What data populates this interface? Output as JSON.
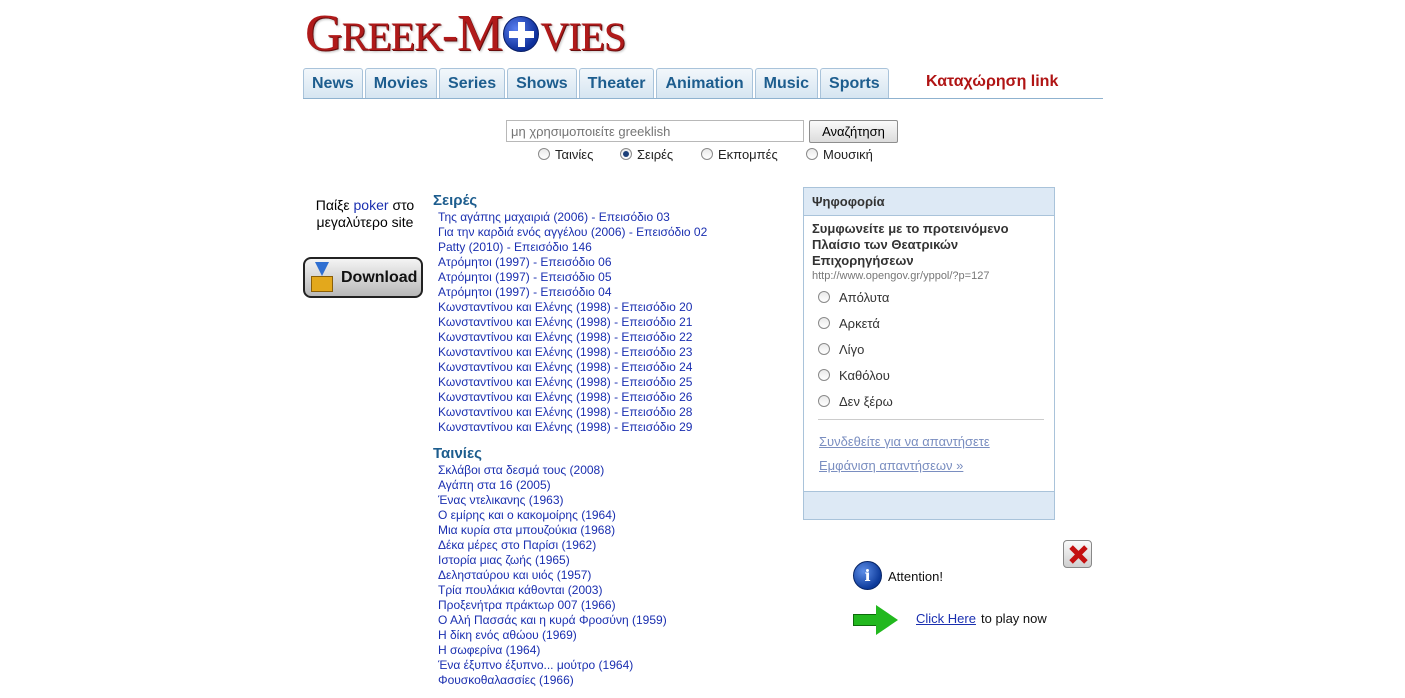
{
  "header": {
    "logo_text": "GREEK-MOVIES",
    "nav": [
      "News",
      "Movies",
      "Series",
      "Shows",
      "Theater",
      "Animation",
      "Music",
      "Sports"
    ],
    "submit_link": "Καταχώρηση link"
  },
  "search": {
    "placeholder": "μη χρησιμοποιείτε greeklish",
    "button_label": "Αναζήτηση",
    "options": [
      "Ταινίες",
      "Σειρές",
      "Εκπομπές",
      "Μουσική"
    ],
    "selected": "Σειρές"
  },
  "left_ad": {
    "text_before": "Παίξε",
    "link": "poker",
    "text_after": "στο μεγαλύτερο site",
    "download_label": "Download"
  },
  "series": {
    "title": "Σειρές",
    "items": [
      "Της αγάπης μαχαιριά (2006) - Επεισόδιο 03",
      "Για την καρδιά ενός αγγέλου (2006) - Επεισόδιο 02",
      "Patty (2010) - Επεισόδιο 146",
      "Ατρόμητοι (1997) - Επεισόδιο 06",
      "Ατρόμητοι (1997) - Επεισόδιο 05",
      "Ατρόμητοι (1997) - Επεισόδιο 04",
      "Κωνσταντίνου και Ελένης (1998) - Επεισόδιο 20",
      "Κωνσταντίνου και Ελένης (1998) - Επεισόδιο 21",
      "Κωνσταντίνου και Ελένης (1998) - Επεισόδιο 22",
      "Κωνσταντίνου και Ελένης (1998) - Επεισόδιο 23",
      "Κωνσταντίνου και Ελένης (1998) - Επεισόδιο 24",
      "Κωνσταντίνου και Ελένης (1998) - Επεισόδιο 25",
      "Κωνσταντίνου και Ελένης (1998) - Επεισόδιο 26",
      "Κωνσταντίνου και Ελένης (1998) - Επεισόδιο 28",
      "Κωνσταντίνου και Ελένης (1998) - Επεισόδιο 29"
    ]
  },
  "movies": {
    "title": "Ταινίες",
    "items": [
      "Σκλάβοι στα δεσμά τους (2008)",
      "Αγάπη στα 16 (2005)",
      "Ένας ντελικανης (1963)",
      "Ο εμίρης και ο κακομοίρης (1964)",
      "Μια κυρία στα μπουζούκια (1968)",
      "Δέκα μέρες στο Παρίσι (1962)",
      "Ιστορία μιας ζωής (1965)",
      "Δελησταύρου και υιός (1957)",
      "Τρία πουλάκια κάθονται (2003)",
      "Προξενήτρα πράκτωρ 007 (1966)",
      "Ο Αλή Πασσάς και η κυρά Φροσύνη (1959)",
      "Η δίκη ενός αθώου (1969)",
      "Η σωφερίνα (1964)",
      "Ένα έξυπνο έξυπνο... μούτρο (1964)",
      "Φουσκοθαλασσίες (1966)"
    ]
  },
  "poll": {
    "header": "Ψηφοφορία",
    "question": "Συμφωνείτε με το προτεινόμενο Πλαίσιο των Θεατρικών Επιχορηγήσεων",
    "url": "http://www.opengov.gr/yppol/?p=127",
    "options": [
      "Απόλυτα",
      "Αρκετά",
      "Λίγο",
      "Καθόλου",
      "Δεν ξέρω"
    ],
    "login_link": "Συνδεθείτε για να απαντήσετε",
    "results_link": "Εμφάνιση απαντήσεων »"
  },
  "popup_ad": {
    "attention": "Attention!",
    "click_here": "Click Here",
    "play_now": "to play now"
  }
}
